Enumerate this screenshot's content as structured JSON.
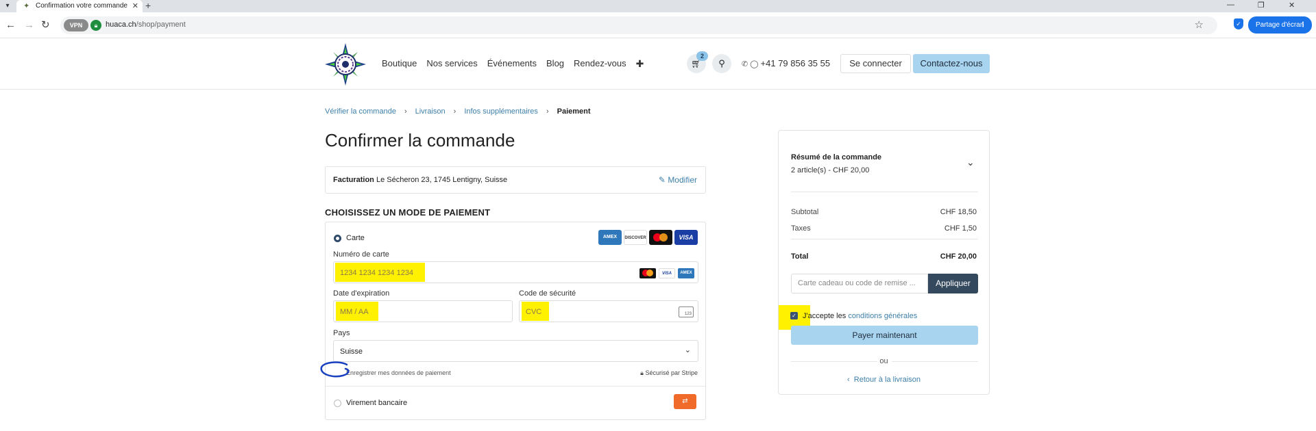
{
  "browser": {
    "tab_title": "Confirmation votre commande",
    "url_host": "huaca.ch",
    "url_path": "/shop/payment",
    "vpn_label": "VPN",
    "share_label": "Partage d'écran"
  },
  "header": {
    "nav": [
      "Boutique",
      "Nos services",
      "Événements",
      "Blog",
      "Rendez-vous",
      "✚"
    ],
    "cart_count": "2",
    "phone": "+41 79 856 35 55",
    "login": "Se connecter",
    "contact": "Contactez-nous"
  },
  "breadcrumb": {
    "items": [
      "Vérifier la commande",
      "Livraison",
      "Infos supplémentaires"
    ],
    "active": "Paiement"
  },
  "page": {
    "title": "Confirmer la commande",
    "billing_label": "Facturation",
    "billing_address": "Le Sécheron 23, 1745 Lentigny, Suisse",
    "modify": "Modifier",
    "section_title": "CHOISISSEZ UN MODE DE PAIEMENT"
  },
  "payment": {
    "card_label": "Carte",
    "card_brands": [
      "AMEX",
      "DISCOVER",
      "Mastercard",
      "VISA"
    ],
    "card_number_label": "Numéro de carte",
    "card_number_placeholder": "1234 1234 1234 1234",
    "expiry_label": "Date d'expiration",
    "expiry_placeholder": "MM / AA",
    "cvc_label": "Code de sécurité",
    "cvc_placeholder": "CVC",
    "cvc_icon_text": "123",
    "country_label": "Pays",
    "country_value": "Suisse",
    "save_label": "Enregistrer mes données de paiement",
    "secure_label": "Sécurisé par Stripe",
    "bank_label": "Virement bancaire"
  },
  "summary": {
    "title": "Résumé de la commande",
    "subtitle": "2 article(s) -  CHF 20,00",
    "subtotal_label": "Subtotal",
    "subtotal_value": "CHF 18,50",
    "taxes_label": "Taxes",
    "taxes_value": "CHF 1,50",
    "total_label": "Total",
    "total_value": "CHF 20,00",
    "gift_placeholder": "Carte cadeau ou code de remise ...",
    "apply": "Appliquer",
    "terms_prefix": "J'accepte les",
    "terms_link": "conditions générales",
    "pay_now": "Payer maintenant",
    "or": "ou",
    "back": "Retour à la livraison"
  },
  "colors": {
    "accent_light": "#a9d4ef",
    "link": "#3d7fa8",
    "highlight": "#fff100",
    "dark_button": "#34495e"
  }
}
